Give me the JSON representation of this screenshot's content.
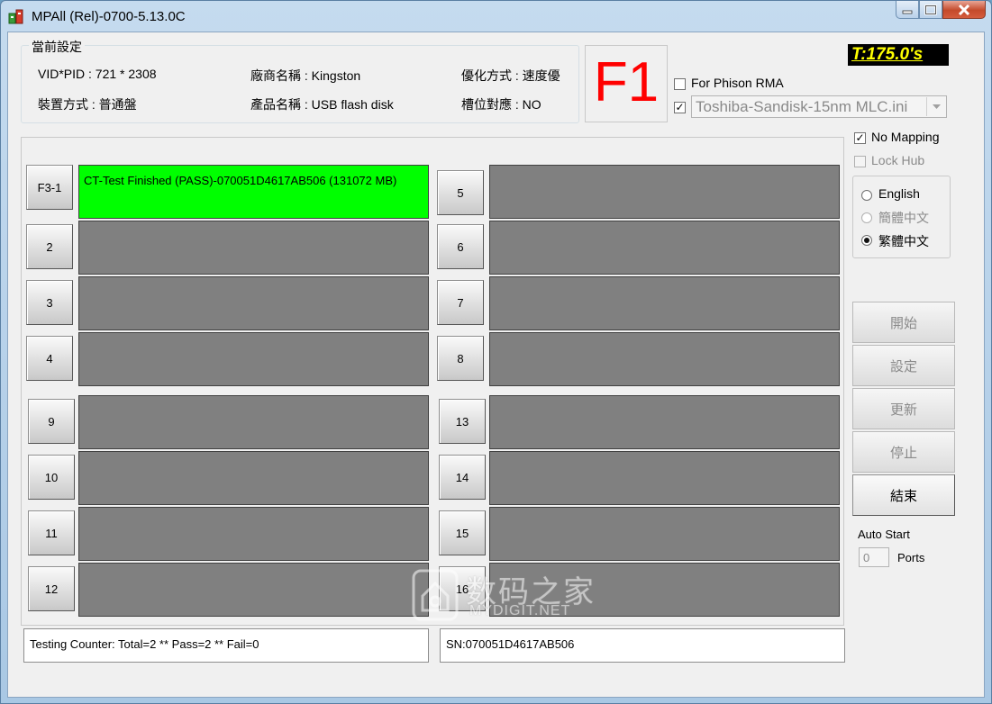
{
  "window": {
    "title": "MPAll (Rel)-0700-5.13.0C"
  },
  "settings": {
    "group_title": "當前設定",
    "vid_pid": "VID*PID :  721 * 2308",
    "vendor": "廠商名稱 : Kingston",
    "optimize": "優化方式 : 速度優",
    "device_mode": "裝置方式 : 普通盤",
    "product": "產品名稱 : USB flash disk",
    "slot_mapping": "槽位對應 : NO"
  },
  "f1_label": "F1",
  "timer": "T:175.0's",
  "options": {
    "phison_rma": "For Phison RMA",
    "phison_rma_checked": false,
    "ini_checked": true,
    "ini_file": "Toshiba-Sandisk-15nm MLC.ini",
    "no_mapping": "No Mapping",
    "no_mapping_checked": true,
    "lock_hub": "Lock Hub",
    "lock_hub_checked": false
  },
  "language": {
    "english": "English",
    "simplified": "簡體中文",
    "traditional": "繁體中文",
    "selected": "traditional"
  },
  "ports": {
    "left": [
      {
        "label": "F3-1",
        "status": "CT-Test Finished (PASS)-070051D4617AB506 (131072 MB)",
        "state": "pass"
      },
      {
        "label": "2",
        "status": "",
        "state": "idle"
      },
      {
        "label": "3",
        "status": "",
        "state": "idle"
      },
      {
        "label": "4",
        "status": "",
        "state": "idle"
      },
      {
        "label": "9",
        "status": "",
        "state": "idle"
      },
      {
        "label": "10",
        "status": "",
        "state": "idle"
      },
      {
        "label": "11",
        "status": "",
        "state": "idle"
      },
      {
        "label": "12",
        "status": "",
        "state": "idle"
      }
    ],
    "right": [
      {
        "label": "5",
        "status": "",
        "state": "idle"
      },
      {
        "label": "6",
        "status": "",
        "state": "idle"
      },
      {
        "label": "7",
        "status": "",
        "state": "idle"
      },
      {
        "label": "8",
        "status": "",
        "state": "idle"
      },
      {
        "label": "13",
        "status": "",
        "state": "idle"
      },
      {
        "label": "14",
        "status": "",
        "state": "idle"
      },
      {
        "label": "15",
        "status": "",
        "state": "idle"
      },
      {
        "label": "16",
        "status": "",
        "state": "idle"
      }
    ]
  },
  "actions": {
    "start": "開始",
    "settings": "設定",
    "update": "更新",
    "stop": "停止",
    "exit": "結束"
  },
  "auto_start": {
    "label": "Auto Start",
    "value": "0",
    "ports_label": "Ports"
  },
  "status": {
    "counter": "Testing Counter: Total=2 ** Pass=2 ** Fail=0",
    "serial": "SN:070051D4617AB506"
  },
  "watermark": {
    "cn": "数码之家",
    "en": "MYDIGIT.NET"
  },
  "colors": {
    "pass": "#00ff00",
    "idle": "#808080",
    "f1": "#ff0000",
    "timer_text": "#ffff00"
  }
}
